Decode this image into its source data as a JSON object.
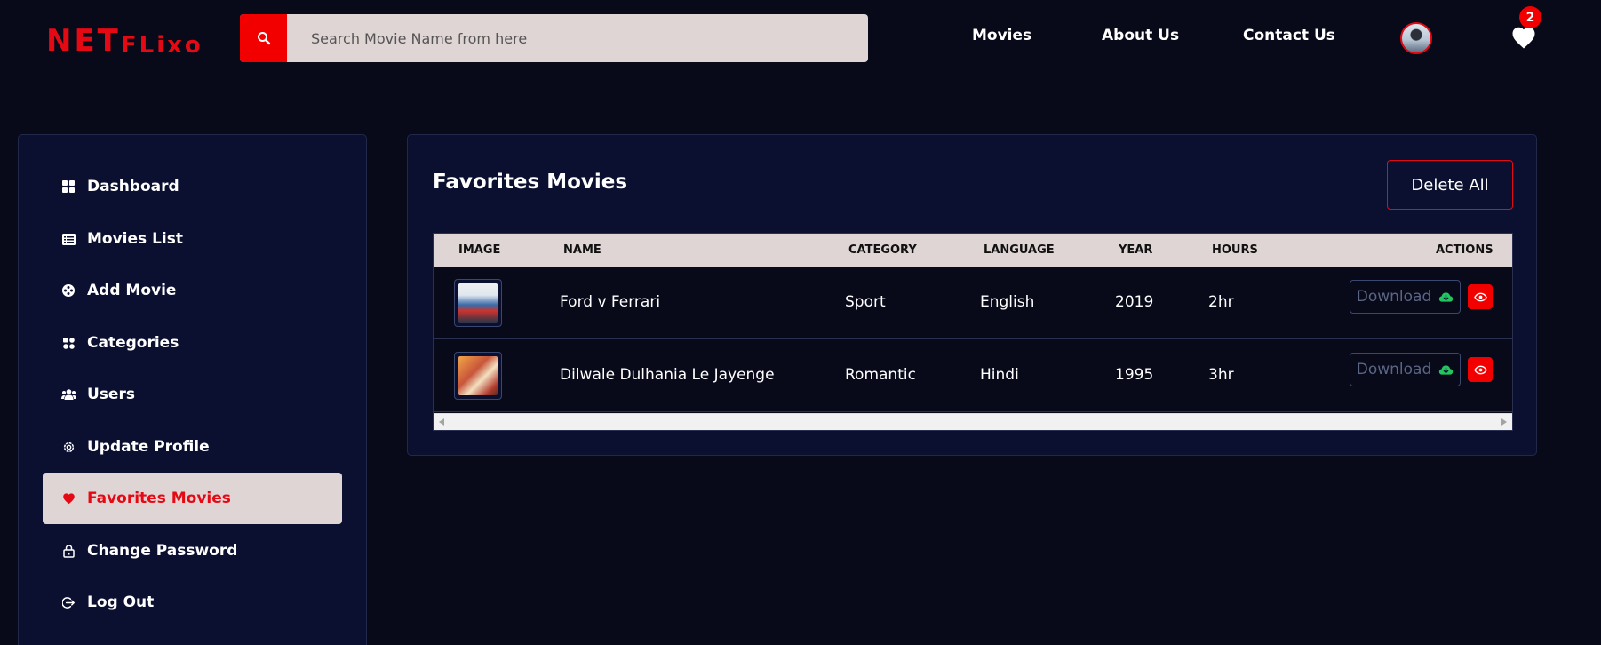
{
  "header": {
    "logo": {
      "part1": "NET",
      "part2": "FLixo"
    },
    "search": {
      "placeholder": "Search Movie Name from here",
      "value": ""
    },
    "nav": [
      {
        "label": "Movies"
      },
      {
        "label": "About Us"
      },
      {
        "label": "Contact Us"
      }
    ],
    "favorites_count": "2"
  },
  "sidebar": {
    "items": [
      {
        "label": "Dashboard",
        "icon": "dashboard-icon"
      },
      {
        "label": "Movies List",
        "icon": "list-icon"
      },
      {
        "label": "Add Movie",
        "icon": "film-reel-icon"
      },
      {
        "label": "Categories",
        "icon": "categories-icon"
      },
      {
        "label": "Users",
        "icon": "users-icon"
      },
      {
        "label": "Update Profile",
        "icon": "gear-icon"
      },
      {
        "label": "Favorites Movies",
        "icon": "heart-icon",
        "active": true
      },
      {
        "label": "Change Password",
        "icon": "lock-icon"
      },
      {
        "label": "Log Out",
        "icon": "logout-icon"
      }
    ]
  },
  "main": {
    "title": "Favorites Movies",
    "delete_all_label": "Delete All",
    "table": {
      "headers": [
        "IMAGE",
        "NAME",
        "CATEGORY",
        "LANGUAGE",
        "YEAR",
        "HOURS",
        "ACTIONS"
      ],
      "rows": [
        {
          "name": "Ford v Ferrari",
          "category": "Sport",
          "language": "English",
          "year": "2019",
          "hours": "2hr",
          "download_label": "Download"
        },
        {
          "name": "Dilwale Dulhania Le Jayenge",
          "category": "Romantic",
          "language": "Hindi",
          "year": "1995",
          "hours": "3hr",
          "download_label": "Download"
        }
      ]
    }
  },
  "colors": {
    "accent": "#e50914",
    "background": "#080a1a",
    "panel": "#0c1030",
    "active_bg": "#e0d5d5",
    "download_icon": "#22c55e"
  }
}
